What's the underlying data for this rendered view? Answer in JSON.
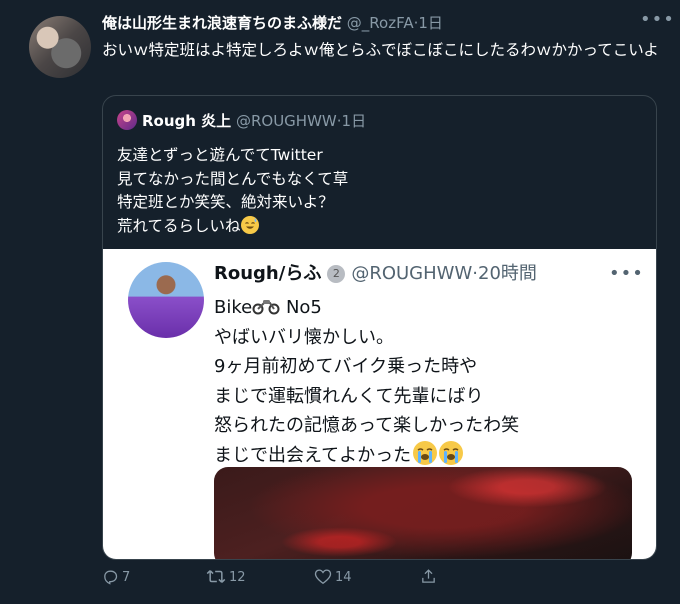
{
  "tweet": {
    "display_name": "俺は山形生まれ浪速育ちのまふ様だ",
    "handle": "@_RozFA",
    "dot": "·",
    "time": "1日",
    "text": "おいｗ特定班はよ特定しろよｗ俺とらふでぼこぼこにしたるわｗかかってこいよ"
  },
  "quote": {
    "display_name": "Rough 炎上",
    "handle": "@ROUGHWW",
    "dot": "·",
    "time": "1日",
    "lines": [
      "友達とずっと遊んでてTwitter",
      "見てなかった間とんでもなくて草",
      "特定班とか笑笑、絶対来いよ？",
      "荒れてるらしいね"
    ],
    "line_emoji": "sweat-smile-emoji"
  },
  "embedded": {
    "display_name": "Rough/らふ",
    "medal_icon": "second-place-medal-icon",
    "handle": "@ROUGHWW",
    "dot": "·",
    "time": "20時間",
    "line1_prefix": "Bike",
    "line1_suffix": "No5",
    "lines": [
      "やばいバリ懐かしい。",
      "9ヶ月前初めてバイク乗った時や",
      "まじで運転慣れんくて先輩にばり",
      "怒られたの記憶あって楽しかったわ笑",
      "まじで出会えてよかった"
    ],
    "line_emoji": "loudly-crying-face-emoji"
  },
  "actions": {
    "reply_count": "7",
    "retweet_count": "12",
    "like_count": "14"
  },
  "colors": {
    "background": "#15202b",
    "secondary_text": "#8899a6",
    "border": "#38444d"
  }
}
